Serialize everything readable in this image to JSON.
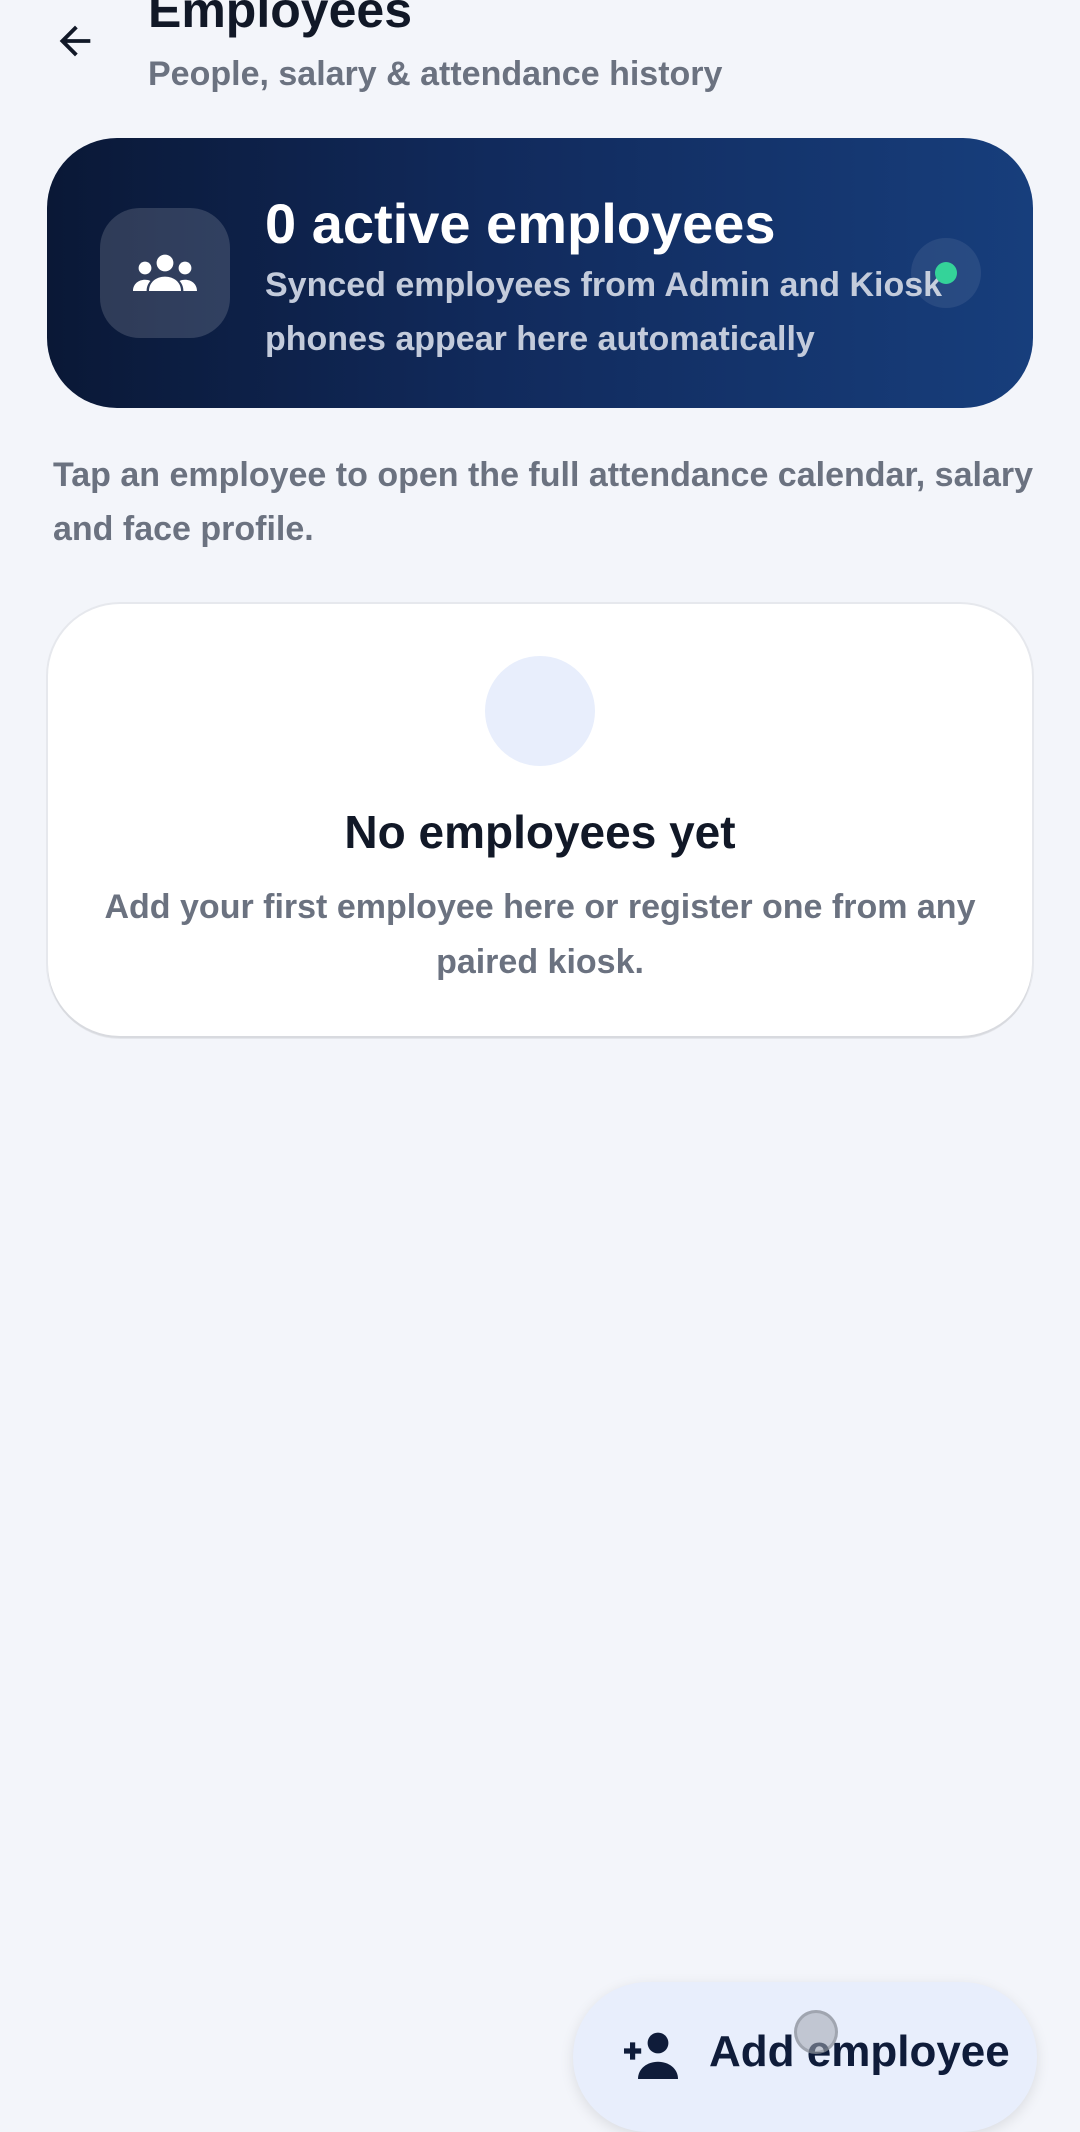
{
  "header": {
    "title": "Employees",
    "subtitle": "People, salary & attendance history",
    "back_icon": "arrow-left-icon"
  },
  "summary_card": {
    "title": "0 active employees",
    "description": "Synced employees from Admin and Kiosk phones appear here automatically",
    "icon": "group-icon",
    "status_color": "#34d399",
    "gradient_start": "#0a1836",
    "gradient_end": "#173e7c"
  },
  "hint": "Tap an employee to open the full attendance calendar, salary and face profile.",
  "empty_state": {
    "title": "No employees yet",
    "description": "Add your first employee here or register one from any paired kiosk."
  },
  "fab": {
    "label": "Add employee",
    "icon": "person-add-icon"
  },
  "colors": {
    "background": "#f3f5fa",
    "muted_text": "#6b7280",
    "fab_background": "#e8eefc"
  }
}
